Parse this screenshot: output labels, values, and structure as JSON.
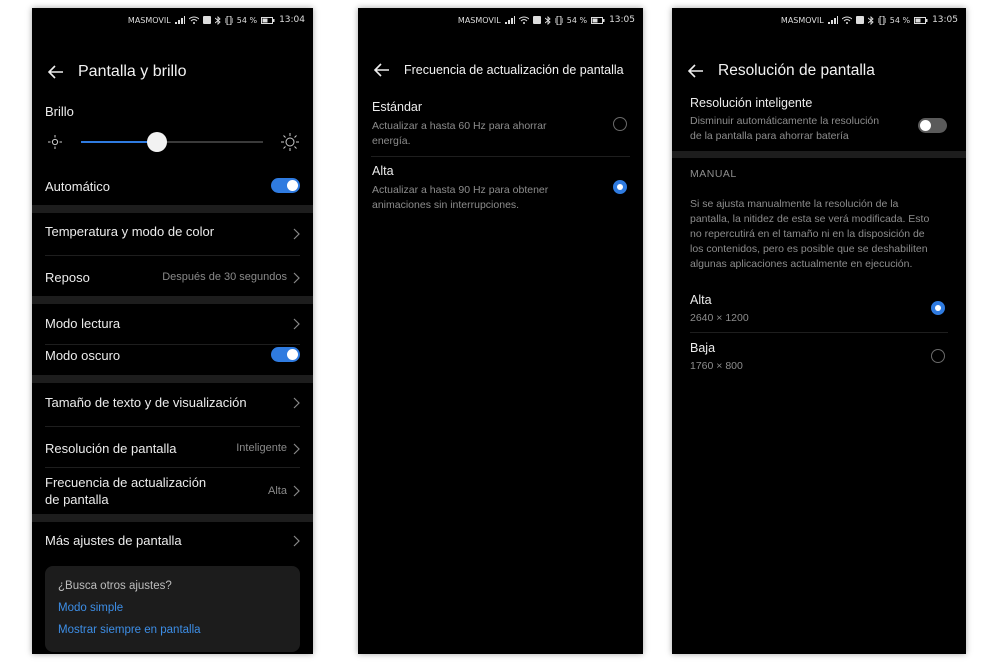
{
  "status1": {
    "carrier": "MASMOVIL",
    "battery": "54 %",
    "time": "13:04"
  },
  "status2": {
    "carrier": "MASMOVIL",
    "battery": "54 %",
    "time": "13:05"
  },
  "status3": {
    "carrier": "MASMOVIL",
    "battery": "54 %",
    "time": "13:05"
  },
  "screen1": {
    "title": "Pantalla y brillo",
    "brightness_label": "Brillo",
    "brightness_level": 0.42,
    "automatic": "Automático",
    "temperature": "Temperatura y modo de color",
    "sleep": "Reposo",
    "sleep_value": "Después de 30 segundos",
    "reading_mode": "Modo lectura",
    "dark_mode": "Modo oscuro",
    "text_size": "Tamaño de texto y de visualización",
    "resolution": "Resolución de pantalla",
    "resolution_value": "Inteligente",
    "refresh_line1": "Frecuencia de actualización",
    "refresh_line2": "de pantalla",
    "refresh_value": "Alta",
    "more": "Más ajustes de pantalla",
    "card_question": "¿Busca otros ajustes?",
    "card_link1": "Modo simple",
    "card_link2": "Mostrar siempre en pantalla",
    "link_color": "#3d8ee6"
  },
  "screen2": {
    "title": "Frecuencia de actualización de pantalla",
    "opt1_title": "Estándar",
    "opt1_line1": "Actualizar a hasta 60 Hz para ahorrar",
    "opt1_line2": "energía.",
    "opt2_title": "Alta",
    "opt2_line1": "Actualizar a hasta 90 Hz para obtener",
    "opt2_line2": "animaciones sin interrupciones.",
    "selected": "Alta"
  },
  "screen3": {
    "title": "Resolución de pantalla",
    "smart_title": "Resolución inteligente",
    "smart_line1": "Disminuir automáticamente la resolución",
    "smart_line2": "de la pantalla para ahorrar batería",
    "manual_header": "MANUAL",
    "desc_line1": "Si se ajusta manualmente la resolución de la",
    "desc_line2": "pantalla, la nitidez de esta se verá modificada. Esto",
    "desc_line3": "no repercutirá en el tamaño ni en la disposición de",
    "desc_line4": "los contenidos, pero es posible que se deshabiliten",
    "desc_line5": "algunas aplicaciones actualmente en ejecución.",
    "opt1_title": "Alta",
    "opt1_value": "2640 × 1200",
    "opt2_title": "Baja",
    "opt2_value": "1760 × 800",
    "selected": "Alta"
  },
  "colors": {
    "accent": "#2f7be0",
    "background": "#000000",
    "separator": "#1d1d1d"
  }
}
